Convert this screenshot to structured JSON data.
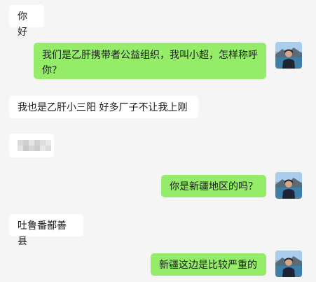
{
  "messages": [
    {
      "id": "m1",
      "direction": "incoming",
      "text": "你好"
    },
    {
      "id": "m2",
      "direction": "outgoing",
      "text": "我们是乙肝携带者公益组织，我叫小超，怎样称呼你？"
    },
    {
      "id": "m3",
      "direction": "incoming",
      "text": "我也是乙肝小三阳  好多厂子不让我上刚"
    },
    {
      "id": "m4",
      "direction": "incoming",
      "text": ""
    },
    {
      "id": "m5",
      "direction": "outgoing",
      "text": "你是新疆地区的吗？"
    },
    {
      "id": "m6",
      "direction": "incoming",
      "text": "吐鲁番鄯善县"
    },
    {
      "id": "m7",
      "direction": "outgoing",
      "text": "新疆这边是比较严重的"
    }
  ],
  "colors": {
    "background": "#f5f5f5",
    "incoming_bubble": "#ffffff",
    "outgoing_bubble": "#95ec69"
  },
  "icons": {
    "avatar": "user-avatar-photo",
    "redacted": "pixelated-redaction-block"
  }
}
